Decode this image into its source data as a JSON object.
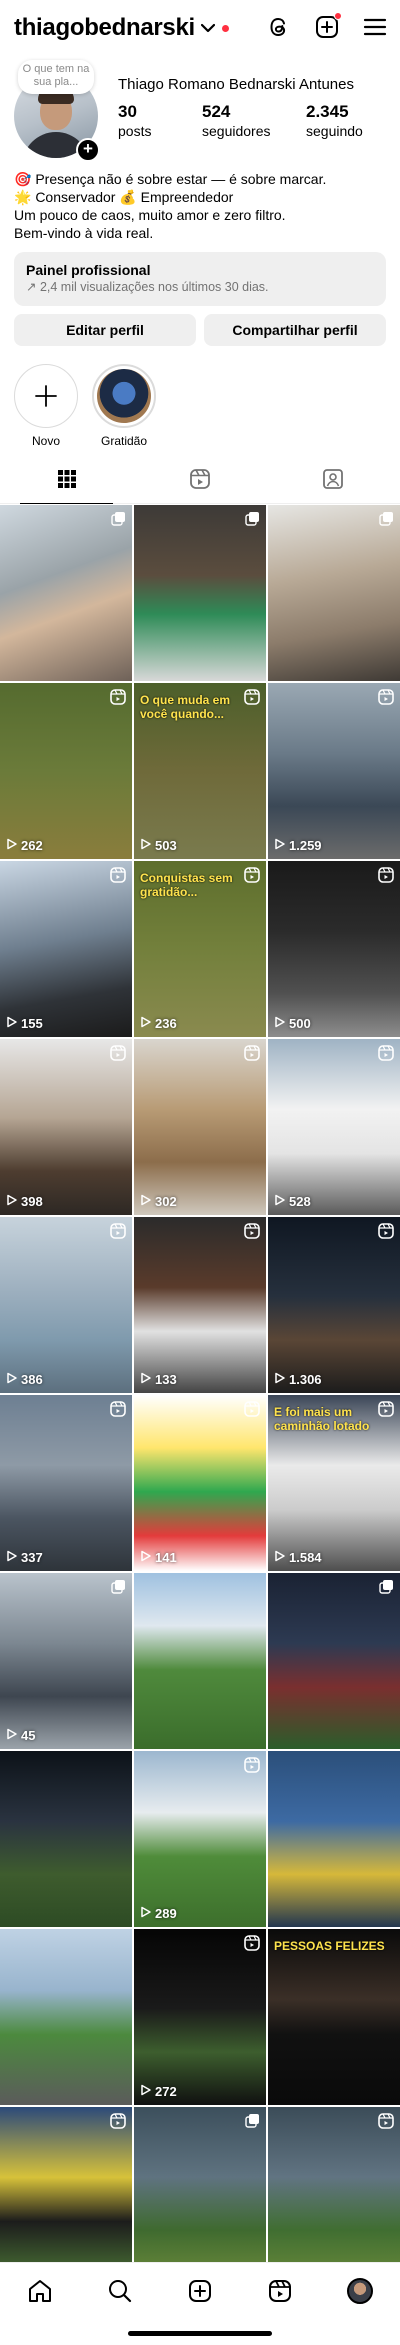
{
  "header": {
    "username": "thiagobednarski",
    "icons": [
      "chevron-down-icon",
      "threads-icon",
      "create-icon",
      "menu-icon"
    ]
  },
  "profile": {
    "note": "O que tem na sua pla...",
    "full_name": "Thiago Romano Bednarski Antunes",
    "stats": [
      {
        "num": "30",
        "label": "posts"
      },
      {
        "num": "524",
        "label": "seguidores"
      },
      {
        "num": "2.345",
        "label": "seguindo"
      }
    ],
    "bio": [
      "🎯 Presença não é sobre estar — é sobre marcar.",
      "🌟 Conservador 💰 Empreendedor",
      "Um pouco de caos, muito amor e zero filtro.",
      "Bem-vindo à vida real."
    ]
  },
  "professional": {
    "title": "Painel profissional",
    "subtitle": "↗ 2,4 mil visualizações nos últimos 30 dias."
  },
  "buttons": {
    "edit": "Editar perfil",
    "share": "Compartilhar perfil"
  },
  "highlights": [
    {
      "label": "Novo"
    },
    {
      "label": "Gratidão"
    }
  ],
  "grid": [
    {
      "type": "multi",
      "views": "",
      "bg": "linear-gradient(160deg,#cfd8df 0%,#9aa3a8 40%,#d3b79c 60%,#6e6158 100%)",
      "caption": ""
    },
    {
      "type": "multi",
      "views": "",
      "bg": "linear-gradient(180deg,#3d3a37 0%,#5b4d3e 40%,#2e8b57 62%,#d8d8d8 100%)",
      "caption": ""
    },
    {
      "type": "multi",
      "views": "",
      "bg": "linear-gradient(170deg,#e6e6e3 0%,#b8a996 40%,#8c7c6b 70%,#3f3a35 100%)",
      "caption": ""
    },
    {
      "type": "reel",
      "views": "262",
      "bg": "linear-gradient(180deg,#556b2f 0%,#6b7b3a 50%,#8a7d3c 100%)",
      "caption": ""
    },
    {
      "type": "reel",
      "views": "503",
      "bg": "linear-gradient(180deg,#4c5f2a 0%,#6f6a3a 50%,#7a7b4e 100%)",
      "caption": "O que muda em você quando..."
    },
    {
      "type": "reel",
      "views": "1.259",
      "bg": "linear-gradient(180deg,#9aa8b3 0%,#6a7a88 40%,#3b4856 70%,#6b6b6b 100%)",
      "caption": ""
    },
    {
      "type": "reel",
      "views": "155",
      "bg": "linear-gradient(170deg,#c9d6e3 0%,#6f7f8f 45%,#2f3338 75%,#1b1b1b 100%)",
      "caption": ""
    },
    {
      "type": "reel",
      "views": "236",
      "bg": "linear-gradient(180deg,#5d6e2c 0%,#73803c 50%,#8a8a4f 100%)",
      "caption": "Conquistas sem gratidão..."
    },
    {
      "type": "reel",
      "views": "500",
      "bg": "linear-gradient(180deg,#1a1a1a 0%,#2b2b2b 40%,#505050 75%,#8d8d8d 100%)",
      "caption": ""
    },
    {
      "type": "reel",
      "views": "398",
      "bg": "linear-gradient(180deg,#e7e7e7 0%,#b5a593 45%,#4e3d30 75%,#2d2824 100%)",
      "caption": ""
    },
    {
      "type": "reel",
      "views": "302",
      "bg": "linear-gradient(180deg,#d9d5ce 0%,#b89b75 40%,#8c6d4b 70%,#cfc8bd 100%)",
      "caption": ""
    },
    {
      "type": "reel",
      "views": "528",
      "bg": "linear-gradient(180deg,#9fb3c4 0%,#f2f2f2 40%,#e4e4e4 65%,#5a5a5a 100%)",
      "caption": ""
    },
    {
      "type": "reel",
      "views": "386",
      "bg": "linear-gradient(180deg,#c7d3dc 0%,#9fb1c0 40%,#7f9aad 70%,#5c6f7e 100%)",
      "caption": ""
    },
    {
      "type": "reel",
      "views": "133",
      "bg": "linear-gradient(180deg,#2b2b2b 0%,#5a3b2b 40%,#e1e1e1 65%,#444 100%)",
      "caption": ""
    },
    {
      "type": "reel",
      "views": "1.306",
      "bg": "linear-gradient(180deg,#0f1722 0%,#26303d 45%,#5a4636 70%,#1c1c1c 100%)",
      "caption": ""
    },
    {
      "type": "reel",
      "views": "337",
      "bg": "linear-gradient(180deg,#6d7f92 0%,#8e9aa6 40%,#4b5561 70%,#2e343a 100%)",
      "caption": ""
    },
    {
      "type": "reel",
      "views": "141",
      "bg": "linear-gradient(180deg,#ffffff 0%,#ffe66d 30%,#2fa84f 55%,#e33b3b 80%,#ffffff 100%)",
      "caption": ""
    },
    {
      "type": "reel",
      "views": "1.584",
      "bg": "linear-gradient(180deg,#3a4556 0%,#eaeaea 40%,#cccccc 65%,#4e4e4e 100%)",
      "caption": "E foi mais um caminhão lotado"
    },
    {
      "type": "multi",
      "views": "45",
      "bg": "linear-gradient(180deg,#b9c3cc 0%,#7c8791 40%,#3e4650 70%,#9ba3aa 100%)",
      "caption": ""
    },
    {
      "type": "none",
      "views": "",
      "bg": "linear-gradient(180deg,#9fc1e0 0%,#dfe8ef 30%,#4f8a3c 55%,#3b6d2c 100%)",
      "caption": ""
    },
    {
      "type": "multi",
      "views": "",
      "bg": "linear-gradient(180deg,#1a2233 0%,#2d3a52 40%,#7a2f2f 65%,#2b5d2b 100%)",
      "caption": ""
    },
    {
      "type": "none",
      "views": "",
      "bg": "linear-gradient(180deg,#0c1218 0%,#2a3340 40%,#3e5c2e 70%,#2d4b24 100%)",
      "caption": ""
    },
    {
      "type": "reel",
      "views": "289",
      "bg": "linear-gradient(180deg,#9cb7cf 0%,#e7ecef 35%,#4f8c3a 60%,#3d6f2c 100%)",
      "caption": ""
    },
    {
      "type": "none",
      "views": "",
      "bg": "linear-gradient(180deg,#2b4f7a 0%,#3d6aa3 40%,#d6b83a 70%,#22364f 100%)",
      "caption": ""
    },
    {
      "type": "none",
      "views": "",
      "bg": "linear-gradient(180deg,#bfd2e4 0%,#98b4cd 35%,#4c8a3e 60%,#5b5b5b 100%)",
      "caption": ""
    },
    {
      "type": "reel",
      "views": "272",
      "bg": "linear-gradient(180deg,#050505 0%,#1a1a1a 45%,#3d5e2e 70%,#101010 100%)",
      "caption": ""
    },
    {
      "type": "none",
      "views": "",
      "bg": "linear-gradient(180deg,#0a0a0a 0%,#3b2f27 40%,#111 60%,#0a0a0a 100%)",
      "caption": "PESSOAS FELIZES"
    },
    {
      "type": "reel",
      "views": "",
      "bg": "linear-gradient(180deg,#2c4a7a 0%,#d7c23a 40%,#1c1c1c 65%,#4e7a37 100%)",
      "caption": ""
    },
    {
      "type": "multi",
      "views": "",
      "bg": "linear-gradient(180deg,#3c4f5c 0%,#5f7380 40%,#3f6a2f 70%,#6e8c3c 100%)",
      "caption": ""
    },
    {
      "type": "reel",
      "views": "",
      "bg": "linear-gradient(180deg,#3b4c58 0%,#617482 40%,#406e31 70%,#6b8a3b 100%)",
      "caption": ""
    }
  ],
  "bottom_nav": [
    "home-icon",
    "search-icon",
    "create-post-icon",
    "reels-icon",
    "profile-avatar"
  ]
}
